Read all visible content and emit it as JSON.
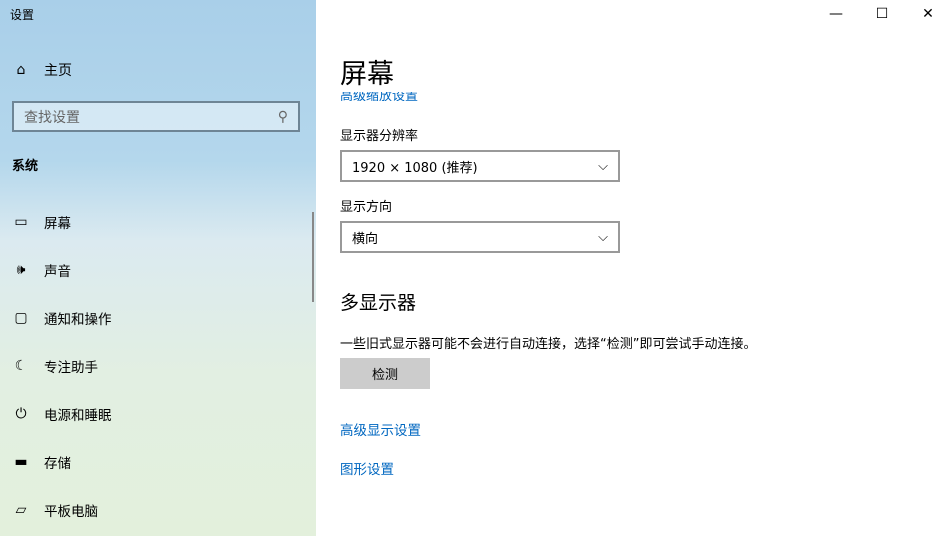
{
  "app_title": "设置",
  "sidebar": {
    "home": "主页",
    "search_placeholder": "查找设置",
    "section": "系统",
    "items": [
      {
        "label": "屏幕",
        "icon": "monitor-icon"
      },
      {
        "label": "声音",
        "icon": "speaker-icon"
      },
      {
        "label": "通知和操作",
        "icon": "notification-icon"
      },
      {
        "label": "专注助手",
        "icon": "moon-icon"
      },
      {
        "label": "电源和睡眠",
        "icon": "power-icon"
      },
      {
        "label": "存储",
        "icon": "storage-icon"
      },
      {
        "label": "平板电脑",
        "icon": "tablet-icon"
      }
    ]
  },
  "main": {
    "title": "屏幕",
    "clipped_link": "高级缩放设置",
    "resolution_label": "显示器分辨率",
    "resolution_value": "1920 × 1080 (推荐)",
    "orientation_label": "显示方向",
    "orientation_value": "横向",
    "multi_heading": "多显示器",
    "multi_desc": "一些旧式显示器可能不会进行自动连接，选择“检测”即可尝试手动连接。",
    "detect_button": "检测",
    "advanced_link": "高级显示设置",
    "graphics_link": "图形设置"
  }
}
